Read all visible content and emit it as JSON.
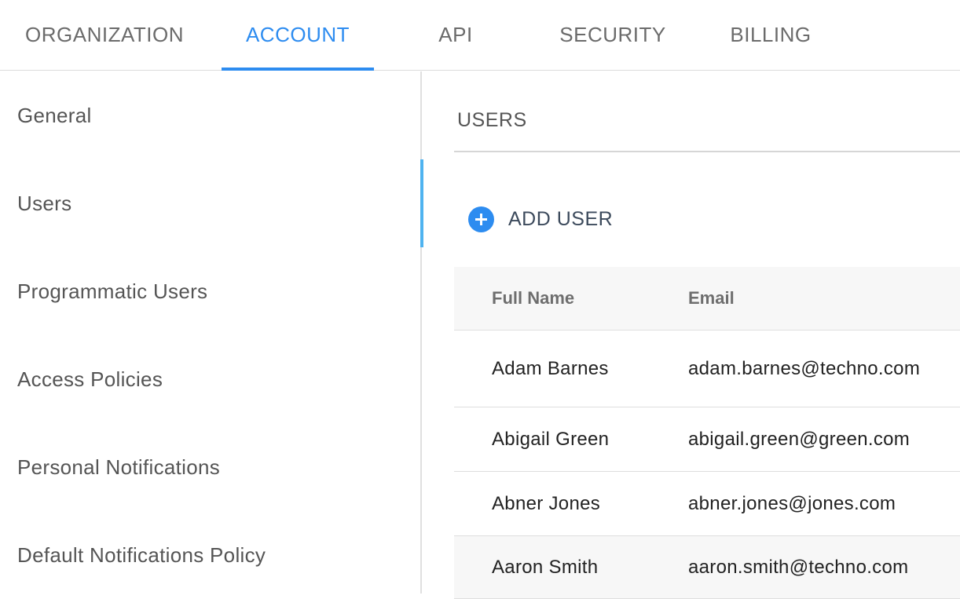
{
  "tabs": [
    {
      "label": "ORGANIZATION"
    },
    {
      "label": "ACCOUNT"
    },
    {
      "label": "API"
    },
    {
      "label": "SECURITY"
    },
    {
      "label": "BILLING"
    }
  ],
  "active_tab": "ACCOUNT",
  "sidebar": {
    "items": [
      {
        "label": "General"
      },
      {
        "label": "Users"
      },
      {
        "label": "Programmatic Users"
      },
      {
        "label": "Access Policies"
      },
      {
        "label": "Personal Notifications"
      },
      {
        "label": "Default Notifications Policy"
      }
    ],
    "active": "Users"
  },
  "main": {
    "section_title": "USERS",
    "add_user_label": "ADD USER",
    "add_user_icon": "plus-circle-icon",
    "table": {
      "columns": [
        "Full Name",
        "Email"
      ],
      "rows": [
        {
          "name": "Adam Barnes",
          "email": "adam.barnes@techno.com"
        },
        {
          "name": "Abigail Green",
          "email": "abigail.green@green.com"
        },
        {
          "name": "Abner Jones",
          "email": "abner.jones@jones.com"
        },
        {
          "name": "Aaron Smith",
          "email": "aaron.smith@techno.com"
        }
      ]
    }
  },
  "colors": {
    "accent": "#2d8cf0",
    "sidebar_active_bar": "#4fb3f0",
    "header_bg": "#f7f7f7"
  }
}
